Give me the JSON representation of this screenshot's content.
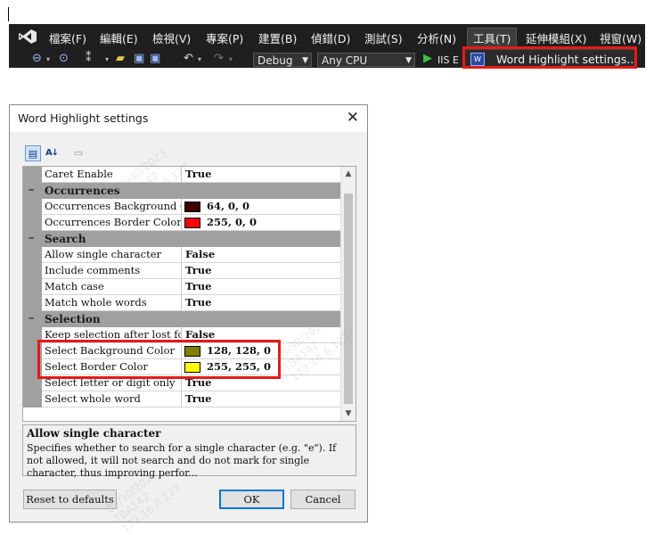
{
  "menubar": {
    "items": [
      "檔案(F)",
      "編輯(E)",
      "檢視(V)",
      "專案(P)",
      "建置(B)",
      "偵錯(D)",
      "測試(S)",
      "分析(N)",
      "工具(T)",
      "延伸模組(X)",
      "視窗(W)"
    ]
  },
  "toolbar": {
    "config": "Debug",
    "platform": "Any CPU",
    "run_label": "IIS E"
  },
  "tools_menu": {
    "item_label": "Word Highlight settings..."
  },
  "dialog": {
    "title": "Word Highlight settings",
    "close_glyph": "✕",
    "rows": [
      {
        "kind": "prop",
        "name": "Caret Enable",
        "value": "True"
      },
      {
        "kind": "cat",
        "toggle": "−",
        "name": "Occurrences"
      },
      {
        "kind": "prop",
        "name": "Occurrences Background Color",
        "value": "64, 0, 0",
        "swatch": "#400000"
      },
      {
        "kind": "prop",
        "name": "Occurrences Border Color",
        "value": "255, 0, 0",
        "swatch": "#ff0000"
      },
      {
        "kind": "cat",
        "toggle": "−",
        "name": "Search"
      },
      {
        "kind": "prop",
        "name": "Allow single character",
        "value": "False"
      },
      {
        "kind": "prop",
        "name": "Include comments",
        "value": "True"
      },
      {
        "kind": "prop",
        "name": "Match case",
        "value": "True"
      },
      {
        "kind": "prop",
        "name": "Match whole words",
        "value": "True"
      },
      {
        "kind": "cat",
        "toggle": "−",
        "name": "Selection"
      },
      {
        "kind": "prop",
        "name": "Keep selection after lost focus",
        "value": "False"
      },
      {
        "kind": "prop",
        "name": "Select Background Color",
        "value": "128, 128, 0",
        "swatch": "#808000"
      },
      {
        "kind": "prop",
        "name": "Select Border Color",
        "value": "255, 255, 0",
        "swatch": "#ffff00"
      },
      {
        "kind": "prop",
        "name": "Select letter or digit only",
        "value": "True"
      },
      {
        "kind": "prop",
        "name": "Select whole word",
        "value": "True"
      }
    ],
    "description": {
      "title": "Allow single character",
      "text": "Specifies whether to search for a single character (e.g. \"e\"). If not allowed, it will not search and do not mark for single character, thus improving perfor..."
    },
    "buttons": {
      "reset": "Reset to defaults",
      "ok": "OK",
      "cancel": "Cancel"
    }
  },
  "watermark": [
    "03/30/2023",
    "TBA142",
    "172.16.6.127"
  ],
  "colors": {
    "highlight_red": "#e51a1a",
    "vs_dark": "#1f1f1f",
    "category_gray": "#a0a0a0"
  }
}
